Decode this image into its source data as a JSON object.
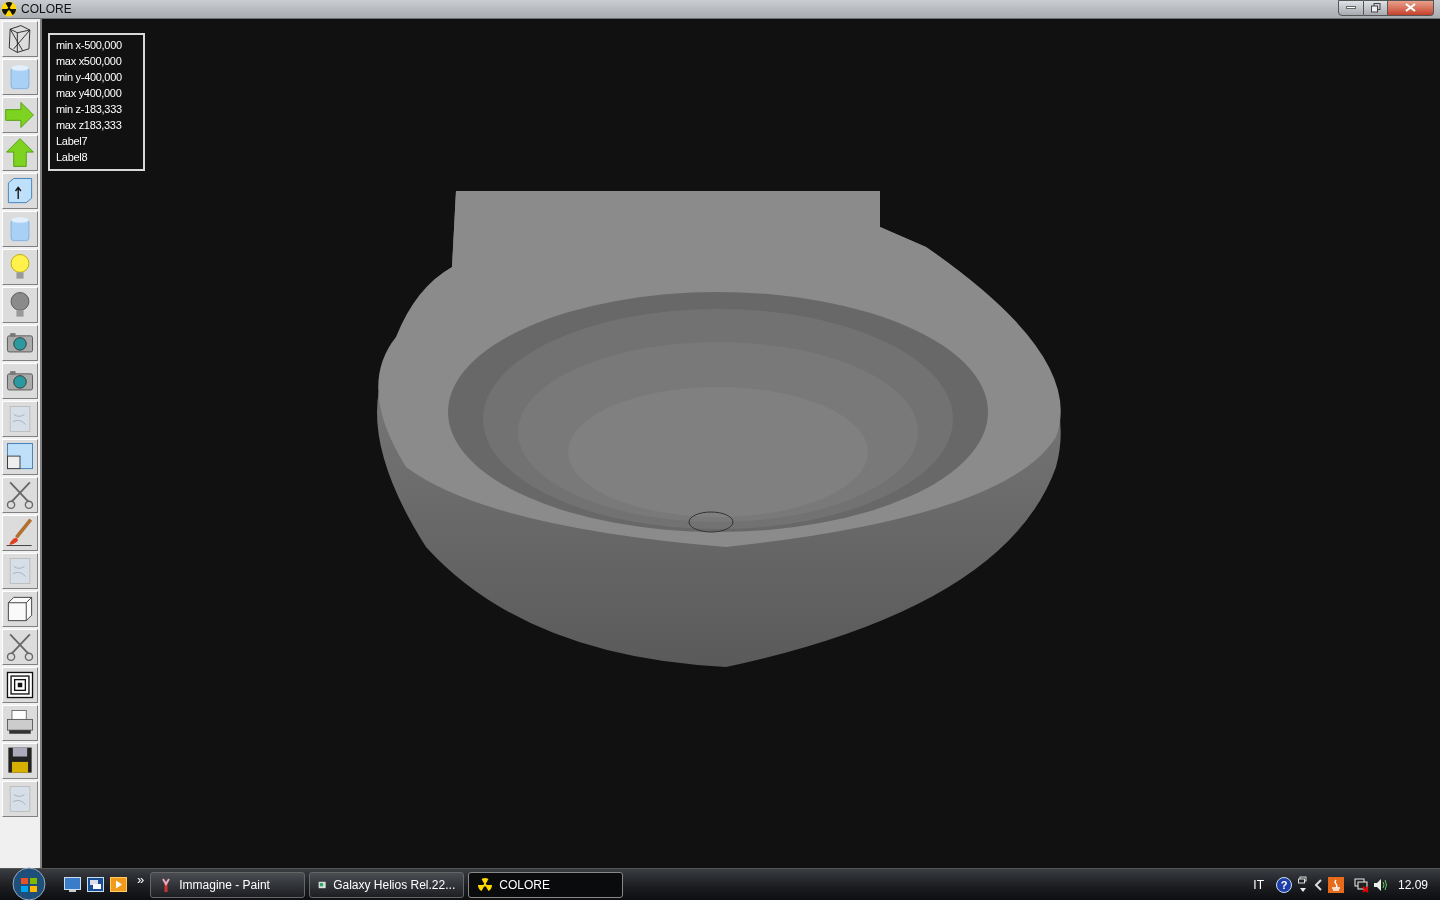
{
  "window": {
    "title": "COLORE"
  },
  "toolbar": [
    {
      "kind": "wireframe"
    },
    {
      "kind": "cylinder"
    },
    {
      "kind": "arrow-right"
    },
    {
      "kind": "arrow-up"
    },
    {
      "kind": "box-arrow"
    },
    {
      "kind": "cylinder"
    },
    {
      "kind": "bulb-on"
    },
    {
      "kind": "bulb-off"
    },
    {
      "kind": "camera"
    },
    {
      "kind": "camera"
    },
    {
      "kind": "texture"
    },
    {
      "kind": "panels"
    },
    {
      "kind": "scissors"
    },
    {
      "kind": "brush"
    },
    {
      "kind": "texture"
    },
    {
      "kind": "cube"
    },
    {
      "kind": "scissors"
    },
    {
      "kind": "squares"
    },
    {
      "kind": "printer"
    },
    {
      "kind": "floppy"
    },
    {
      "kind": "texture"
    }
  ],
  "info_labels": [
    "min x-500,000",
    "max x500,000",
    "min y-400,000",
    "max y400,000",
    "min z-183,333",
    "max z183,333",
    "Label7",
    "Label8"
  ],
  "taskbar": {
    "quick_launch_more": "»",
    "tasks": [
      {
        "label": "Immagine - Paint",
        "kind": "paint",
        "selected": false
      },
      {
        "label": "Galaxy Helios  Rel.22...",
        "kind": "helios",
        "selected": false
      },
      {
        "label": "COLORE",
        "kind": "colore",
        "selected": true
      }
    ],
    "language": "IT",
    "help_glyph": "?",
    "clock": "12.09"
  }
}
